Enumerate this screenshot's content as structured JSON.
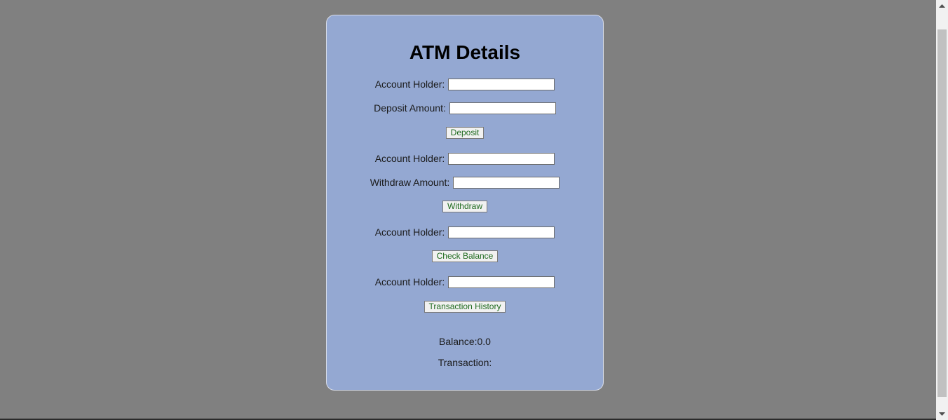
{
  "form": {
    "title": "ATM Details",
    "deposit": {
      "account_label": "Account Holder:",
      "account_value": "",
      "amount_label": "Deposit Amount:",
      "amount_value": "",
      "button_label": "Deposit"
    },
    "withdraw": {
      "account_label": "Account Holder:",
      "account_value": "",
      "amount_label": "Withdraw Amount:",
      "amount_value": "",
      "button_label": "Withdraw"
    },
    "balance": {
      "account_label": "Account Holder:",
      "account_value": "",
      "button_label": "Check Balance"
    },
    "history": {
      "account_label": "Account Holder:",
      "account_value": "",
      "button_label": "Transaction History"
    },
    "balance_text": "Balance:0.0",
    "transaction_text": "Transaction:"
  },
  "colors": {
    "page_background": "#808080",
    "card_background": "#94a8d2",
    "button_text": "#1f6b1f"
  },
  "scrollbar": {
    "up_icon": "scroll-up-arrow",
    "down_icon": "scroll-down-arrow"
  }
}
